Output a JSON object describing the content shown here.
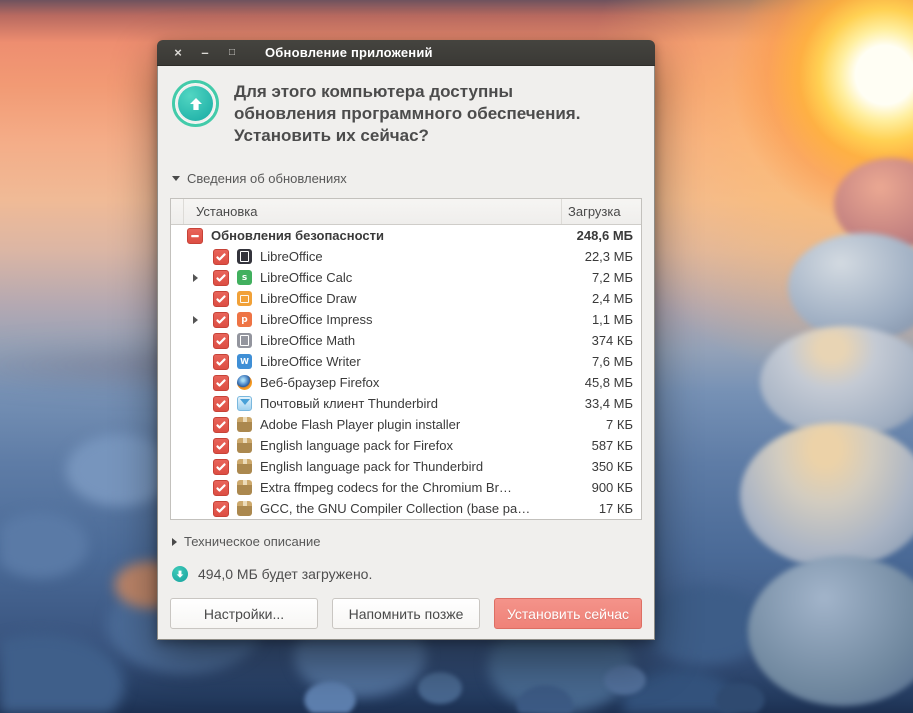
{
  "window": {
    "title": "Обновление приложений",
    "controls": {
      "close": "×",
      "minimize": "–",
      "maximize": "□"
    }
  },
  "header": {
    "message_lines": [
      "Для этого компьютера доступны",
      "обновления программного обеспечения.",
      "Установить их сейчас?"
    ]
  },
  "details_expander": {
    "label": "Сведения об обновлениях",
    "state": "expanded"
  },
  "table": {
    "columns": [
      "Установка",
      "Загрузка"
    ],
    "group": {
      "label": "Обновления безопасности",
      "size": "248,6 МБ",
      "checkbox": "partial"
    },
    "rows": [
      {
        "label": "LibreOffice",
        "size": "22,3 МБ",
        "icon": "libreoffice",
        "expandable": false
      },
      {
        "label": "LibreOffice Calc",
        "size": "7,2 МБ",
        "icon": "calc",
        "expandable": true
      },
      {
        "label": "LibreOffice Draw",
        "size": "2,4 МБ",
        "icon": "draw",
        "expandable": false
      },
      {
        "label": "LibreOffice Impress",
        "size": "1,1 МБ",
        "icon": "impress",
        "expandable": true
      },
      {
        "label": "LibreOffice Math",
        "size": "374 КБ",
        "icon": "math",
        "expandable": false
      },
      {
        "label": "LibreOffice Writer",
        "size": "7,6 МБ",
        "icon": "writer",
        "expandable": false
      },
      {
        "label": "Веб-браузер Firefox",
        "size": "45,8 МБ",
        "icon": "firefox",
        "expandable": false
      },
      {
        "label": "Почтовый клиент Thunderbird",
        "size": "33,4 МБ",
        "icon": "thunderbird",
        "expandable": false
      },
      {
        "label": "Adobe Flash Player plugin installer",
        "size": "7 КБ",
        "icon": "package",
        "expandable": false
      },
      {
        "label": "English language pack for Firefox",
        "size": "587 КБ",
        "icon": "package",
        "expandable": false
      },
      {
        "label": "English language pack for Thunderbird",
        "size": "350 КБ",
        "icon": "package",
        "expandable": false
      },
      {
        "label": "Extra ffmpeg codecs for the Chromium Br…",
        "size": "900 КБ",
        "icon": "package",
        "expandable": false
      },
      {
        "label": "GCC, the GNU Compiler Collection (base pa…",
        "size": "17 КБ",
        "icon": "package",
        "expandable": false
      }
    ]
  },
  "tech_expander": {
    "label": "Техническое описание",
    "state": "collapsed"
  },
  "download_note": "494,0 МБ будет загружено.",
  "buttons": {
    "settings": "Настройки...",
    "remind": "Напомнить позже",
    "install": "Установить сейчас"
  },
  "colors": {
    "titlebar_bg": "#3c3b37",
    "dialog_bg": "#f0efed",
    "checkbox_red": "#dd4e43",
    "install_button": "#ef8278",
    "updater_teal": "#25b5ab"
  }
}
